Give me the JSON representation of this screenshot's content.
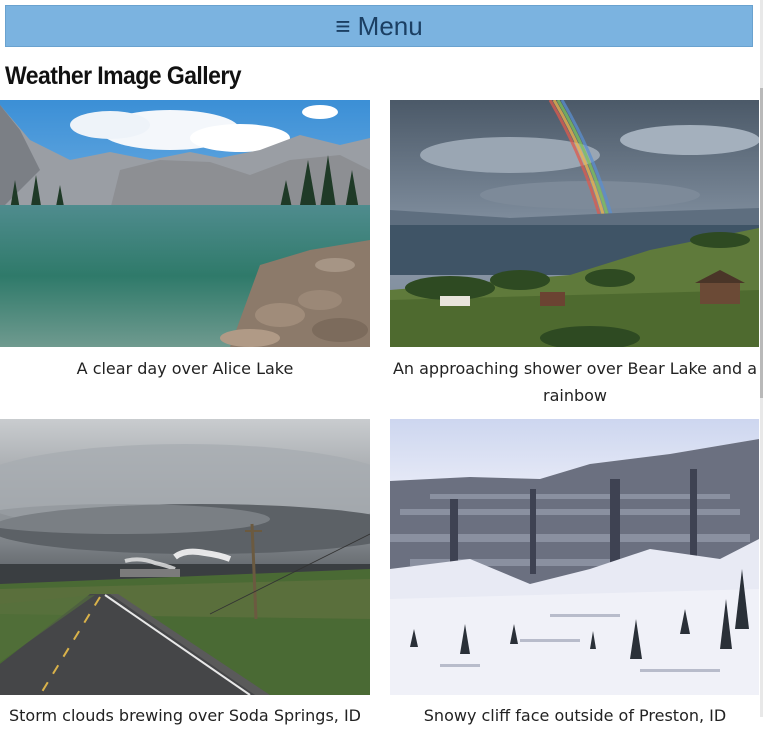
{
  "menu": {
    "icon": "hamburger-icon",
    "label": "≡ Menu"
  },
  "gallery": {
    "title": "Weather Image Gallery",
    "images": [
      {
        "caption": "A clear day over Alice Lake"
      },
      {
        "caption": "An approaching shower over Bear Lake and a rainbow"
      },
      {
        "caption": "Storm clouds brewing over Soda Springs, ID"
      },
      {
        "caption": "Snowy cliff face outside of Preston, ID"
      }
    ]
  },
  "colors": {
    "menu_bg": "#7bb3e0",
    "menu_text": "#1b3f63"
  }
}
